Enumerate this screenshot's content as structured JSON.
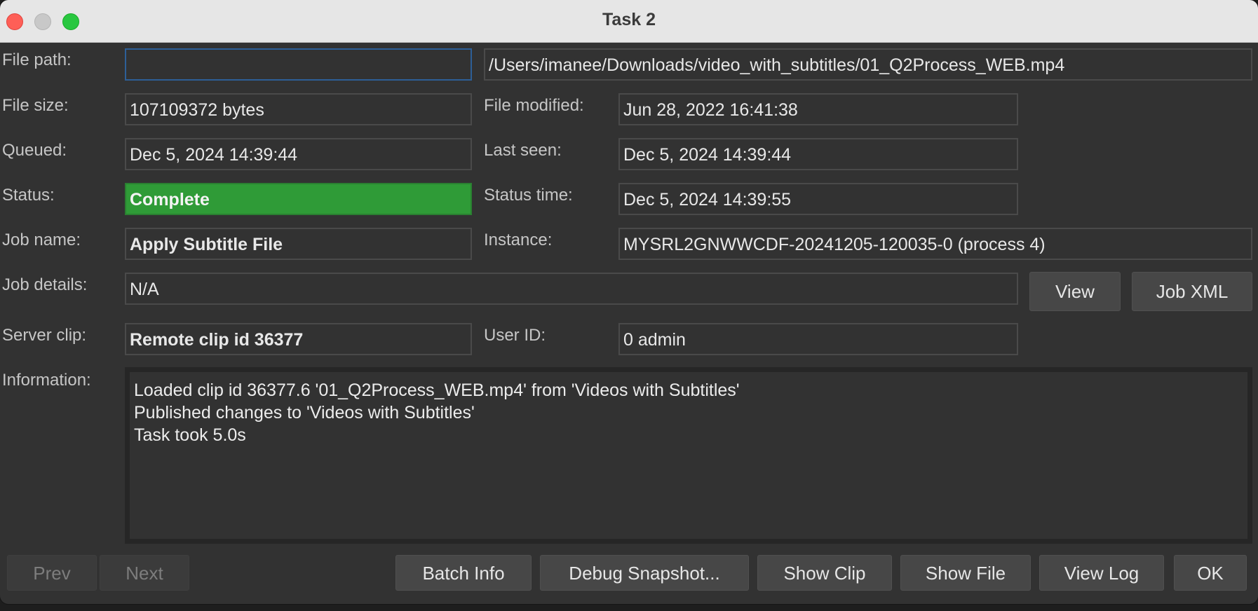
{
  "window": {
    "title": "Task 2"
  },
  "labels": {
    "file_path": "File path:",
    "file_size": "File size:",
    "file_modified": "File modified:",
    "queued": "Queued:",
    "last_seen": "Last seen:",
    "status": "Status:",
    "status_time": "Status time:",
    "job_name": "Job name:",
    "instance": "Instance:",
    "job_details": "Job details:",
    "server_clip": "Server clip:",
    "user_id": "User ID:",
    "information": "Information:"
  },
  "values": {
    "file_path_input": "",
    "file_path": "/Users/imanee/Downloads/video_with_subtitles/01_Q2Process_WEB.mp4",
    "file_size": "107109372 bytes",
    "file_modified": "Jun 28, 2022 16:41:38",
    "queued": "Dec 5, 2024 14:39:44",
    "last_seen": "Dec 5, 2024 14:39:44",
    "status": "Complete",
    "status_color": "#2f9b37",
    "status_time": "Dec 5, 2024 14:39:55",
    "job_name": "Apply Subtitle File",
    "instance": "MYSRL2GNWWCDF-20241205-120035-0 (process 4)",
    "job_details": "N/A",
    "server_clip": "Remote clip id 36377",
    "user_id": "0 admin"
  },
  "information": {
    "lines": [
      "Loaded clip id 36377.6 '01_Q2Process_WEB.mp4' from 'Videos with Subtitles'",
      "Published changes to 'Videos with Subtitles'",
      "Task took 5.0s"
    ]
  },
  "buttons": {
    "view": "View",
    "job_xml": "Job XML",
    "prev": "Prev",
    "next": "Next",
    "batch_info": "Batch Info",
    "debug_snapshot": "Debug Snapshot...",
    "show_clip": "Show Clip",
    "show_file": "Show File",
    "view_log": "View Log",
    "ok": "OK"
  }
}
